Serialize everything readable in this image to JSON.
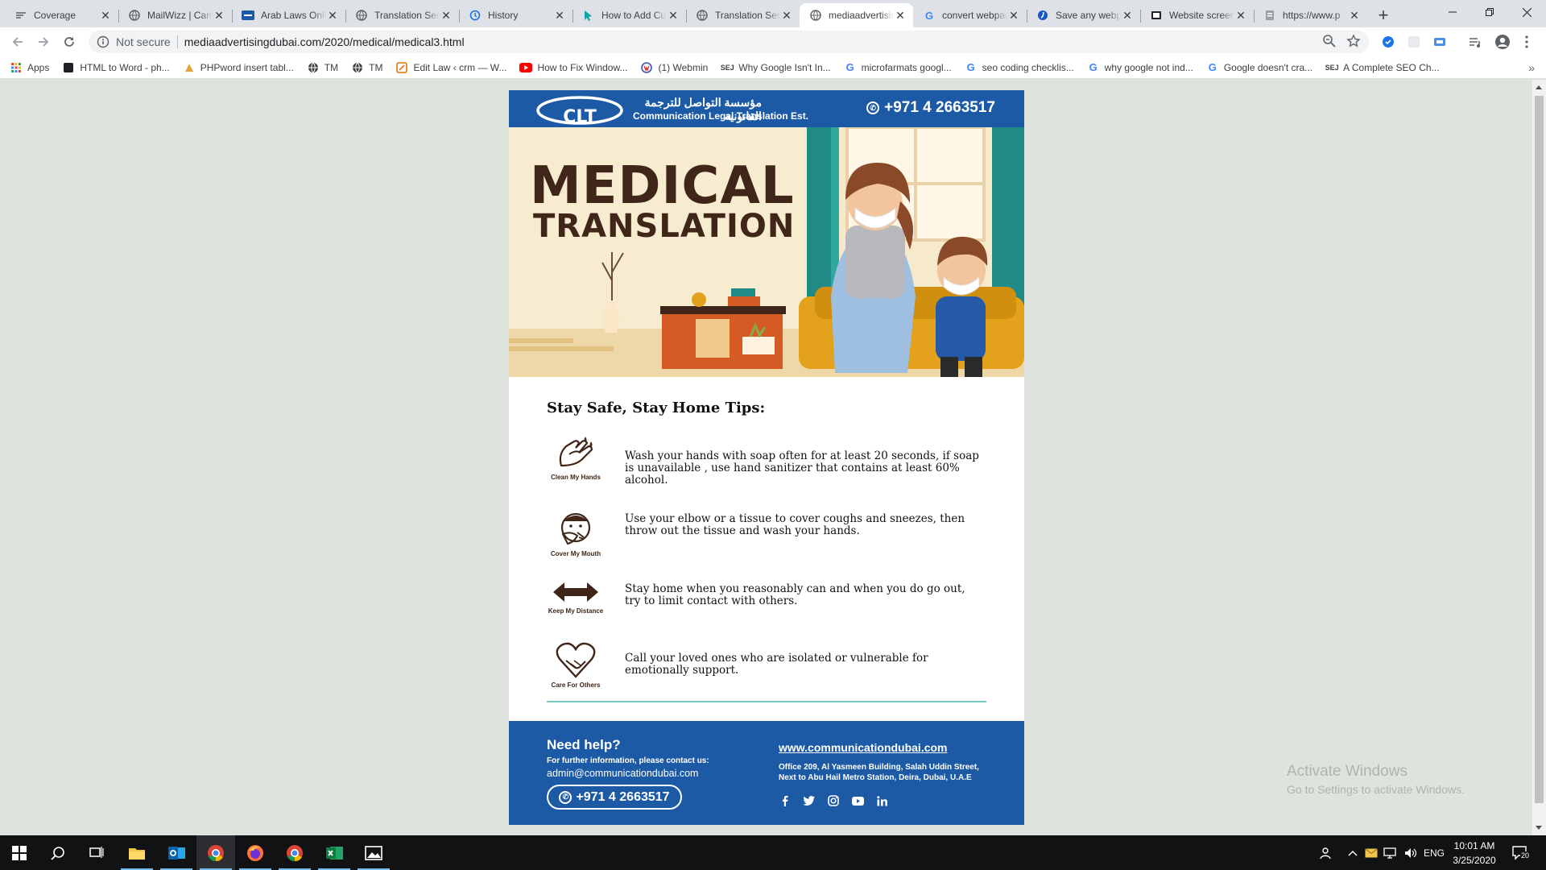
{
  "tabs": [
    {
      "title": "Coverage",
      "icon": "coverage-icon"
    },
    {
      "title": "MailWizz | Campaigns",
      "icon": "globe-icon"
    },
    {
      "title": "Arab Laws Online",
      "icon": "arab-laws-icon"
    },
    {
      "title": "Translation Services",
      "icon": "globe-icon"
    },
    {
      "title": "History",
      "icon": "history-icon"
    },
    {
      "title": "How to Add Cursor",
      "icon": "cursor-icon"
    },
    {
      "title": "Translation Services",
      "icon": "globe-icon"
    },
    {
      "title": "mediaadvertisingdubai",
      "icon": "globe-icon",
      "active": true
    },
    {
      "title": "convert webpage",
      "icon": "google-icon"
    },
    {
      "title": "Save any webpage",
      "icon": "save-web-icon"
    },
    {
      "title": "Website screenshot",
      "icon": "screenshot-icon"
    },
    {
      "title": "https://www.p",
      "icon": "page-icon"
    }
  ],
  "omnibox": {
    "security": "Not secure",
    "url": "mediaadvertisingdubai.com/2020/medical/medical3.html"
  },
  "bookmarks": [
    {
      "label": "Apps",
      "icon": "apps-icon"
    },
    {
      "label": "HTML to Word - ph...",
      "icon": "bookmark-dark-icon"
    },
    {
      "label": "PHPword insert tabl...",
      "icon": "phpword-icon"
    },
    {
      "label": "TM",
      "icon": "globe-icon"
    },
    {
      "label": "TM",
      "icon": "globe-icon"
    },
    {
      "label": "Edit Law ‹ crm — W...",
      "icon": "edit-law-icon"
    },
    {
      "label": "How to Fix Window...",
      "icon": "youtube-icon"
    },
    {
      "label": "(1) Webmin",
      "icon": "webmin-icon"
    },
    {
      "label": "Why Google Isn't In...",
      "icon": "sej-icon"
    },
    {
      "label": "microfarmats googl...",
      "icon": "google-icon"
    },
    {
      "label": "seo coding checklis...",
      "icon": "google-icon"
    },
    {
      "label": "why google not ind...",
      "icon": "google-icon"
    },
    {
      "label": "Google doesn't cra...",
      "icon": "google-icon"
    },
    {
      "label": "A Complete SEO Ch...",
      "icon": "sej-icon"
    }
  ],
  "email": {
    "header": {
      "brand_ar": "مؤسسة التواصل للترجمة القانونية",
      "brand_en": "Communication Legal Translation Est.",
      "logo_text": "CLT",
      "phone": "+971 4 2663517"
    },
    "hero": {
      "title_line1": "MEDICAL",
      "title_line2": "TRANSLATION"
    },
    "tips_heading": "Stay Safe, Stay Home Tips:",
    "tips": [
      {
        "icon": "clean-hands-icon",
        "icon_label": "Clean My Hands",
        "text": "Wash your hands with soap often for at least 20 seconds, if soap is unavailable , use hand sanitizer that contains at least 60% alcohol."
      },
      {
        "icon": "cover-mouth-icon",
        "icon_label": "Cover My Mouth",
        "text": "Use your elbow or a tissue to cover coughs and sneezes, then throw out the tissue and wash your hands."
      },
      {
        "icon": "keep-distance-icon",
        "icon_label": "Keep My Distance",
        "text": "Stay home when you reasonably can and when you do go out, try to limit contact with others."
      },
      {
        "icon": "care-others-icon",
        "icon_label": "Care For Others",
        "text": "Call your loved ones who are isolated or vulnerable for emotionally support."
      }
    ],
    "footer": {
      "need_help": "Need help?",
      "further": "For further information, please contact us:",
      "email": "admin@communicationdubai.com",
      "phone": "+971 4 2663517",
      "website": "www.communicationdubai.com",
      "address_line1": "Office 209, Al Yasmeen Building, Salah Uddin Street,",
      "address_line2": "Next to Abu Hail Metro Station, Deira, Dubai, U.A.E",
      "socials": [
        "facebook-icon",
        "twitter-icon",
        "instagram-icon",
        "youtube-icon",
        "linkedin-icon"
      ]
    }
  },
  "watermark": {
    "title": "Activate Windows",
    "subtitle": "Go to Settings to activate Windows."
  },
  "taskbar": {
    "language": "ENG",
    "time": "10:01 AM",
    "date": "3/25/2020",
    "notifications": "20"
  },
  "colors": {
    "brand_blue": "#1c5aa6",
    "hero_brown": "#3f2618",
    "hero_bg": "#f8ecd0",
    "rule_teal": "#79c6be",
    "page_bg": "#dfe3de"
  }
}
